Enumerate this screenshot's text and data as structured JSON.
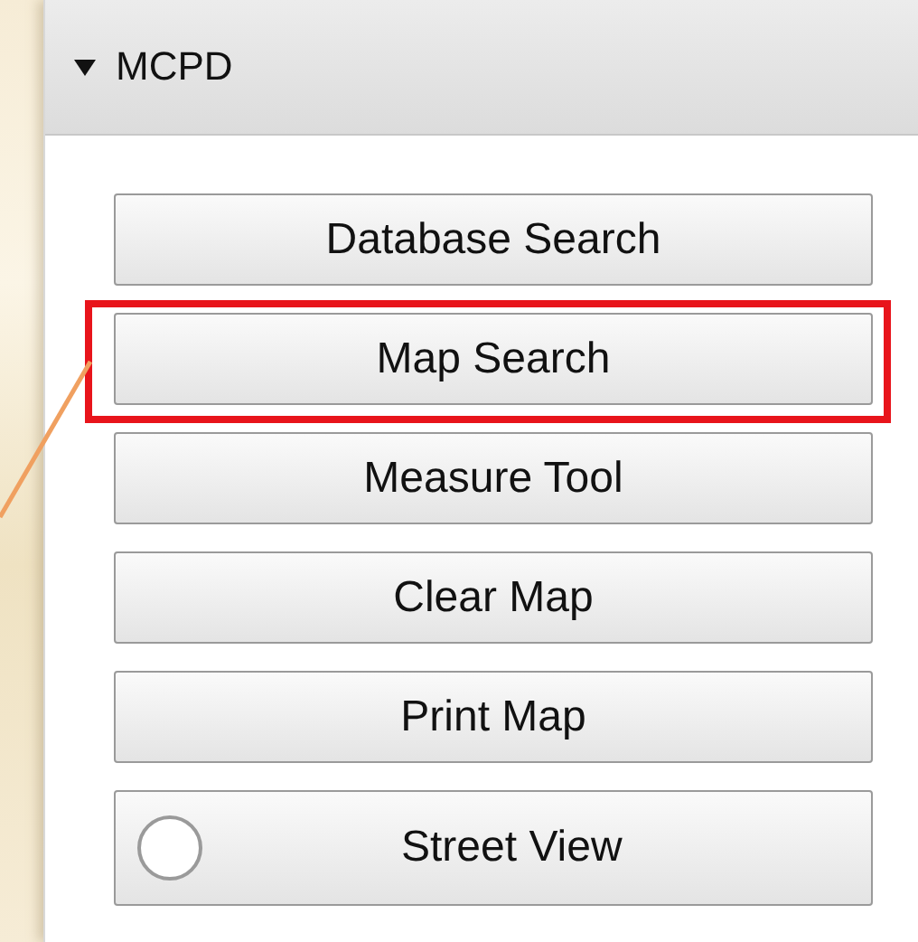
{
  "panel": {
    "title": "MCPD",
    "expanded": true
  },
  "buttons": [
    {
      "label": "Database Search",
      "kind": "plain",
      "highlighted": false
    },
    {
      "label": "Map Search",
      "kind": "plain",
      "highlighted": true
    },
    {
      "label": "Measure Tool",
      "kind": "plain",
      "highlighted": false
    },
    {
      "label": "Clear Map",
      "kind": "plain",
      "highlighted": false
    },
    {
      "label": "Print Map",
      "kind": "plain",
      "highlighted": false
    },
    {
      "label": "Street View",
      "kind": "toggle",
      "on": false,
      "highlighted": false
    }
  ]
}
